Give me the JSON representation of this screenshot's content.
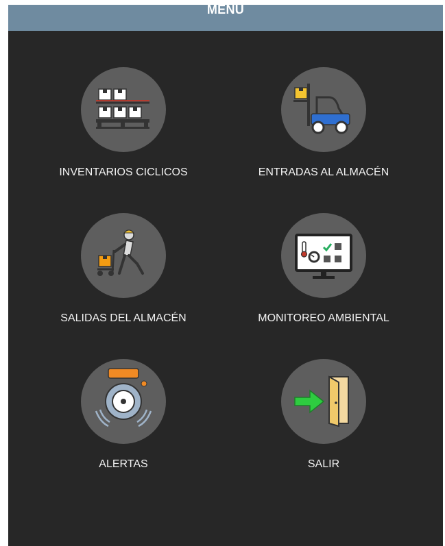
{
  "header": {
    "title": "MENU"
  },
  "colors": {
    "background": "#272727",
    "header": "#6f8ba0",
    "circle": "#5e5e5e",
    "label": "#f2f2f2"
  },
  "menu": {
    "items": [
      {
        "label": "INVENTARIOS CICLICOS",
        "icon": "boxes-on-pallet-icon"
      },
      {
        "label": "ENTRADAS AL ALMACÉN",
        "icon": "forklift-icon"
      },
      {
        "label": "SALIDAS DEL ALMACÉN",
        "icon": "worker-pushing-cart-icon"
      },
      {
        "label": "MONITOREO AMBIENTAL",
        "icon": "monitor-dashboard-icon"
      },
      {
        "label": "ALERTAS",
        "icon": "alarm-bell-icon"
      },
      {
        "label": "SALIR",
        "icon": "exit-door-icon"
      }
    ]
  }
}
